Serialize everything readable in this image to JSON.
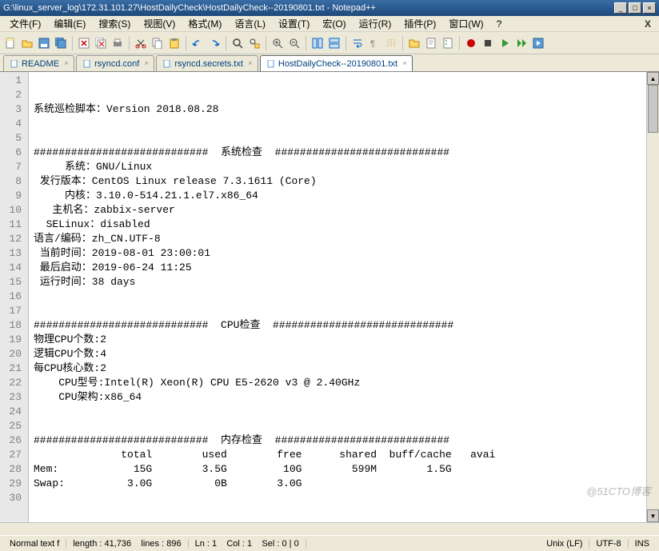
{
  "title": "G:\\linux_server_log\\172.31.101.27\\HostDailyCheck\\HostDailyCheck--20190801.txt - Notepad++",
  "menus": [
    "文件(F)",
    "编辑(E)",
    "搜索(S)",
    "视图(V)",
    "格式(M)",
    "语言(L)",
    "设置(T)",
    "宏(O)",
    "运行(R)",
    "插件(P)",
    "窗口(W)",
    "?"
  ],
  "tabs": [
    {
      "label": "README",
      "active": false
    },
    {
      "label": "rsyncd.conf",
      "active": false
    },
    {
      "label": "rsyncd.secrets.txt",
      "active": false
    },
    {
      "label": "HostDailyCheck--20190801.txt",
      "active": true
    }
  ],
  "lines": [
    "",
    "",
    "系统巡检脚本：Version 2018.08.28",
    "",
    "",
    "############################  系统检查  ############################",
    "     系统：GNU/Linux",
    " 发行版本：CentOS Linux release 7.3.1611 (Core)",
    "     内核：3.10.0-514.21.1.el7.x86_64",
    "   主机名：zabbix-server",
    "  SELinux：disabled",
    "语言/编码：zh_CN.UTF-8",
    " 当前时间：2019-08-01 23:00:01",
    " 最后启动：2019-06-24 11:25",
    " 运行时间：38 days",
    "",
    "",
    "############################  CPU检查  #############################",
    "物理CPU个数:2",
    "逻辑CPU个数:4",
    "每CPU核心数:2",
    "    CPU型号:Intel(R) Xeon(R) CPU E5-2620 v3 @ 2.40GHz",
    "    CPU架构:x86_64",
    "",
    "",
    "############################  内存检查  ############################",
    "              total        used        free      shared  buff/cache   avai",
    "Mem:            15G        3.5G         10G        599M        1.5G",
    "Swap:          3.0G          0B        3.0G",
    ""
  ],
  "status": {
    "type": "Normal text f",
    "length_label": "length :",
    "length": "41,736",
    "lines_label": "lines :",
    "lines": "896",
    "ln_label": "Ln :",
    "ln": "1",
    "col_label": "Col :",
    "col": "1",
    "sel_label": "Sel :",
    "sel": "0 | 0",
    "eol": "Unix (LF)",
    "encoding": "UTF-8",
    "ovr": "INS"
  },
  "watermark": "@51CTO博客"
}
